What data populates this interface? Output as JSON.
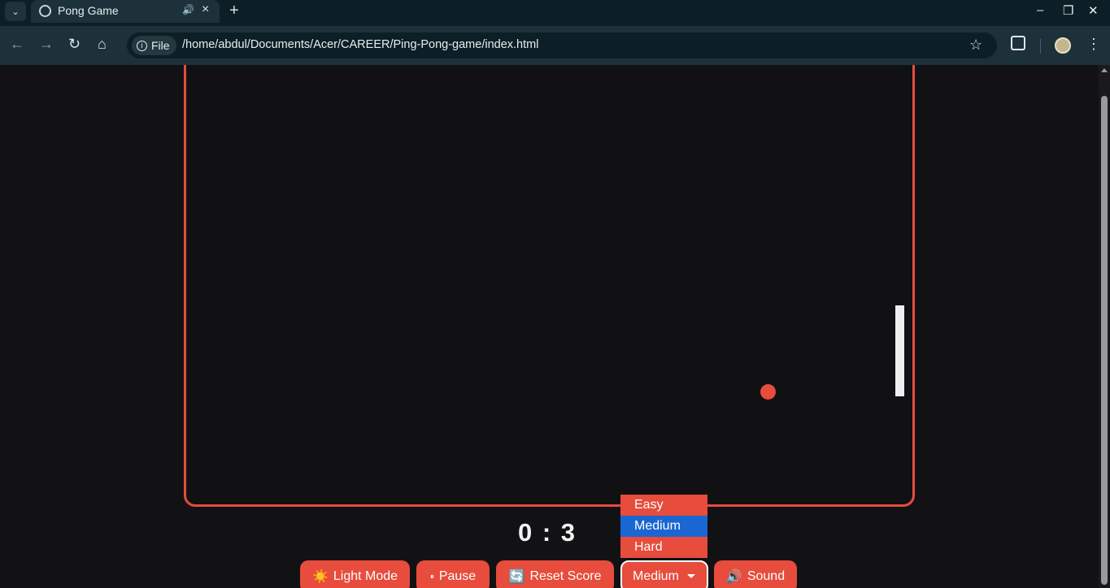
{
  "browser": {
    "tab_title": "Pong Game",
    "address_chip": "File",
    "url": "/home/abdul/Documents/Acer/CAREER/Ping-Pong-game/index.html"
  },
  "game": {
    "score_left": "0",
    "score_separator": ":",
    "score_right": "3",
    "accent_color": "#e74c3c"
  },
  "controls": {
    "light_mode_icon": "☀️",
    "light_mode_label": "Light Mode",
    "pause_icon": "⏸",
    "pause_label": "Pause",
    "reset_icon": "🔄",
    "reset_label": "Reset Score",
    "difficulty_selected": "Medium",
    "difficulty_options": [
      "Easy",
      "Medium",
      "Hard"
    ],
    "sound_icon": "🔊",
    "sound_label": "Sound"
  }
}
